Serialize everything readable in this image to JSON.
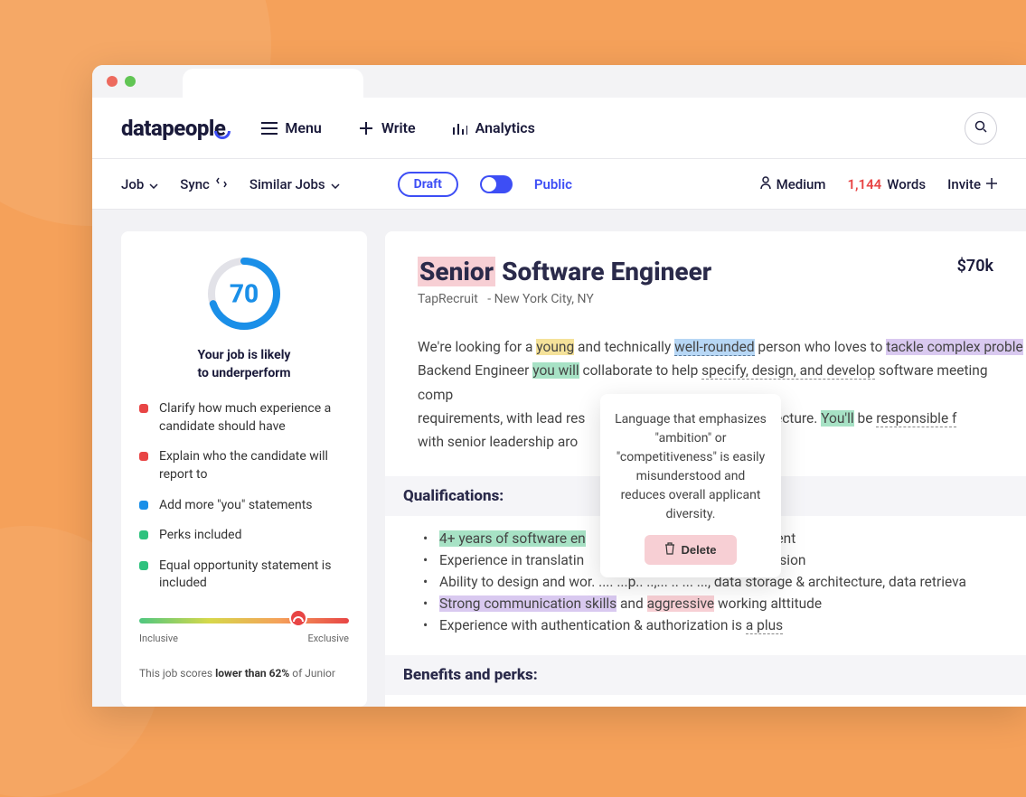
{
  "brand": "datapeople",
  "nav": {
    "menu": "Menu",
    "write": "Write",
    "analytics": "Analytics"
  },
  "subbar": {
    "job": "Job",
    "sync": "Sync",
    "similar": "Similar Jobs",
    "draft": "Draft",
    "public": "Public",
    "medium": "Medium",
    "word_count": "1,144",
    "words_label": "Words",
    "invite": "Invite"
  },
  "score": {
    "value": "70",
    "caption_l1": "Your job is likely",
    "caption_l2": "to underperform"
  },
  "recommendations": [
    {
      "color": "red",
      "text": "Clarify how much experience a candidate should have"
    },
    {
      "color": "red",
      "text": "Explain who the candidate will report to"
    },
    {
      "color": "blue",
      "text": "Add more \"you\" statements"
    },
    {
      "color": "green",
      "text": "Perks included"
    },
    {
      "color": "green",
      "text": "Equal opportunity statement is included"
    }
  ],
  "inclusion": {
    "left": "Inclusive",
    "right": "Exclusive"
  },
  "footer": {
    "pre": "This job scores ",
    "bold": "lower than 62%",
    "post": " of Junior"
  },
  "job": {
    "title_hl": "Senior",
    "title_rest": " Software Engineer",
    "company": "TapRecruit",
    "location": "New York City, NY",
    "salary": "$70k",
    "body": {
      "p1_a": "We're looking for a ",
      "p1_young": "young",
      "p1_b": " and technically ",
      "p1_well": "well-rounded",
      "p1_c": " person who loves to ",
      "p1_tackle": "tackle complex proble",
      "p2_a": "Backend Engineer ",
      "p2_youwill": "you will",
      "p2_b": " collaborate to help ",
      "p2_sdd": "specify, design, and develop",
      "p2_c": " software meeting comp",
      "p3_a": "requirements, with lead res ",
      "p3_gap": "                               ",
      "p3_b": " of the architecture. ",
      "p3_youll": "You'll",
      "p3_c": " be ",
      "p3_resp": "responsible f",
      "p4": "with senior leadership aro"
    },
    "qual_h": "Qualifications:",
    "quals": {
      "q1_hl": "4+ years of software en",
      "q1_rest": "                                  d development",
      "q2_a": "Experience in translatin",
      "q2_b": "                                    technical vision",
      "q3": "Ability to design and wor.   ....  ...p.. ..,... .. ... ..., data storage & architecture, data retrieva",
      "q4_a_hl": "Strong communication skills",
      "q4_b": " and ",
      "q4_c_hl": "aggressive",
      "q4_d": " working alttitude",
      "q5_a": "Experience with authentication & authorization is ",
      "q5_b": "a plus"
    },
    "benefits_h": "Benefits and perks:"
  },
  "tooltip": {
    "text": "Language that emphasizes \"ambition\" or \"competitiveness\" is easily misunderstood and reduces overall applicant diversity.",
    "delete": "Delete"
  }
}
